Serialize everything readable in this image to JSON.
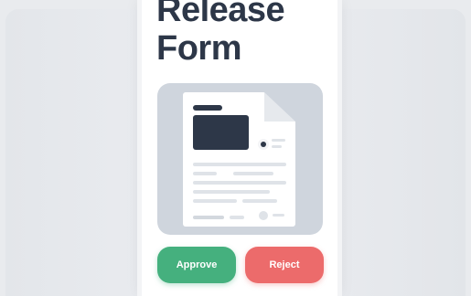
{
  "page": {
    "title_line1": "Release",
    "title_line2": "Form"
  },
  "document_illustration": {
    "icon": "document-icon",
    "avatar_icon": "user-avatar-icon",
    "colors": {
      "card": "#cfd5dd",
      "sheet": "#ffffff",
      "ink": "#2d3748",
      "placeholder_lines": "#dfe3e8"
    }
  },
  "actions": {
    "approve_label": "Approve",
    "reject_label": "Reject",
    "approve_color": "#45b07e",
    "reject_color": "#ec6b6b"
  }
}
